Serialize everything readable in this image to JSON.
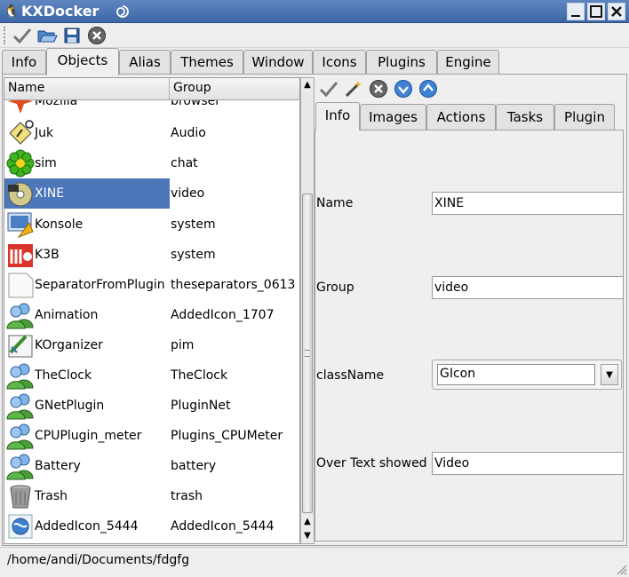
{
  "window": {
    "title": "KXDocker",
    "app_icon": "tux-icon",
    "sticky_icon": "swirl-icon",
    "controls": [
      "minimize-icon",
      "maximize-icon",
      "close-icon"
    ]
  },
  "toolbar": {
    "buttons": [
      "apply-icon",
      "open-icon",
      "save-icon",
      "quit-icon"
    ]
  },
  "tabs": [
    {
      "label": "Info"
    },
    {
      "label": "Objects",
      "active": true
    },
    {
      "label": "Alias"
    },
    {
      "label": "Themes"
    },
    {
      "label": "Window"
    },
    {
      "label": "Icons"
    },
    {
      "label": "Plugins"
    },
    {
      "label": "Engine"
    }
  ],
  "list": {
    "columns": [
      "Name",
      "Group"
    ],
    "rows": [
      {
        "name": "Mozilla",
        "group": "browser",
        "icon": "mozilla-icon"
      },
      {
        "name": "Juk",
        "group": "Audio",
        "icon": "juk-icon"
      },
      {
        "name": "sim",
        "group": "chat",
        "icon": "sim-icon"
      },
      {
        "name": "XINE",
        "group": "video",
        "icon": "xine-icon",
        "selected": true
      },
      {
        "name": "Konsole",
        "group": "system",
        "icon": "konsole-icon"
      },
      {
        "name": "K3B",
        "group": "system",
        "icon": "k3b-icon"
      },
      {
        "name": "SeparatorFromPlugin",
        "group": "theseparators_0613",
        "icon": "blank-document-icon"
      },
      {
        "name": "Animation",
        "group": "AddedIcon_1707",
        "icon": "users-icon"
      },
      {
        "name": "KOrganizer",
        "group": "pim",
        "icon": "korganizer-icon"
      },
      {
        "name": "TheClock",
        "group": "TheClock",
        "icon": "users-icon"
      },
      {
        "name": "GNetPlugin",
        "group": "PluginNet",
        "icon": "users-icon"
      },
      {
        "name": "CPUPlugin_meter",
        "group": "Plugins_CPUMeter",
        "icon": "users-icon"
      },
      {
        "name": "Battery",
        "group": "battery",
        "icon": "users-icon"
      },
      {
        "name": "Trash",
        "group": "trash",
        "icon": "trash-icon"
      },
      {
        "name": "AddedIcon_5444",
        "group": "AddedIcon_5444",
        "icon": "globe-icon"
      }
    ]
  },
  "detail_toolbar": {
    "buttons": [
      "apply-icon",
      "wand-icon",
      "remove-icon",
      "move-down-icon",
      "move-up-icon"
    ]
  },
  "subtabs": [
    {
      "label": "Info",
      "active": true
    },
    {
      "label": "Images"
    },
    {
      "label": "Actions"
    },
    {
      "label": "Tasks"
    },
    {
      "label": "Plugin"
    }
  ],
  "form": {
    "name_label": "Name",
    "name_value": "XINE",
    "group_label": "Group",
    "group_value": "video",
    "classname_label": "className",
    "classname_value": "GIcon",
    "overtext_label": "Over Text showed",
    "overtext_value": "Video"
  },
  "status": {
    "path": "/home/andi/Documents/fdgfg"
  }
}
